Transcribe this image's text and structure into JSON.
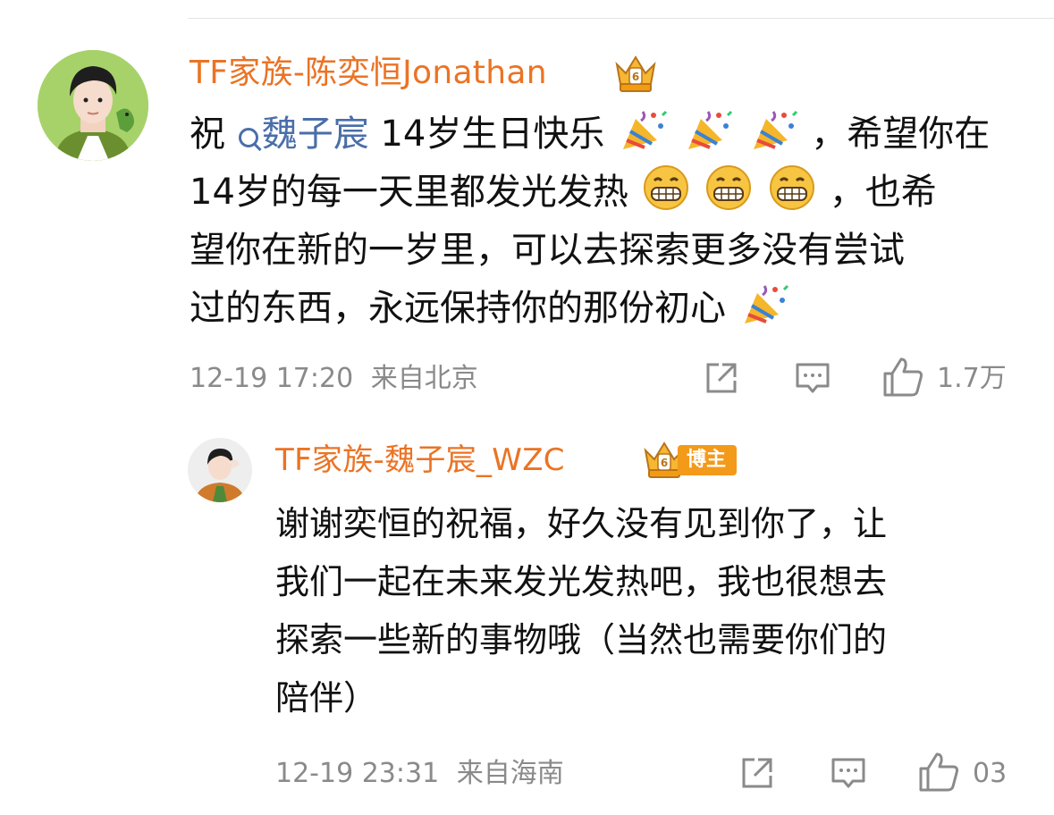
{
  "comment": {
    "username": "TF家族-陈奕恒Jonathan",
    "content": {
      "prefix": "祝",
      "mention": "魏子宸",
      "line1_text": "14岁生日快乐",
      "line1_after": "，希望你在",
      "line2_text": "14岁的每一天里都发光发热",
      "line2_after": "，也希",
      "line3": "望你在新的一岁里，可以去探索更多没有尝试",
      "line4_text": "过的东西，永远保持你的那份初心"
    },
    "timestamp": "12-19 17:20",
    "location": "来自北京",
    "likes": "1.7万"
  },
  "reply": {
    "username": "TF家族-魏子宸_WZC",
    "badge": "博主",
    "lines": [
      "谢谢奕恒的祝福，好久没有见到你了，让",
      "我们一起在未来发光发热吧，我也很想去",
      "探索一些新的事物哦（当然也需要你们的",
      "陪伴）"
    ],
    "timestamp": "12-19 23:31",
    "location": "来自海南",
    "likes": "03"
  },
  "colors": {
    "username": "#eb7324",
    "mention": "#4a6ea9",
    "meta": "#8a8a8a",
    "badge": "#f49a1a"
  },
  "icons": [
    "party-popper-icon",
    "grin-emoji-icon",
    "share-icon",
    "comment-icon",
    "like-icon",
    "crown-badge-icon"
  ]
}
